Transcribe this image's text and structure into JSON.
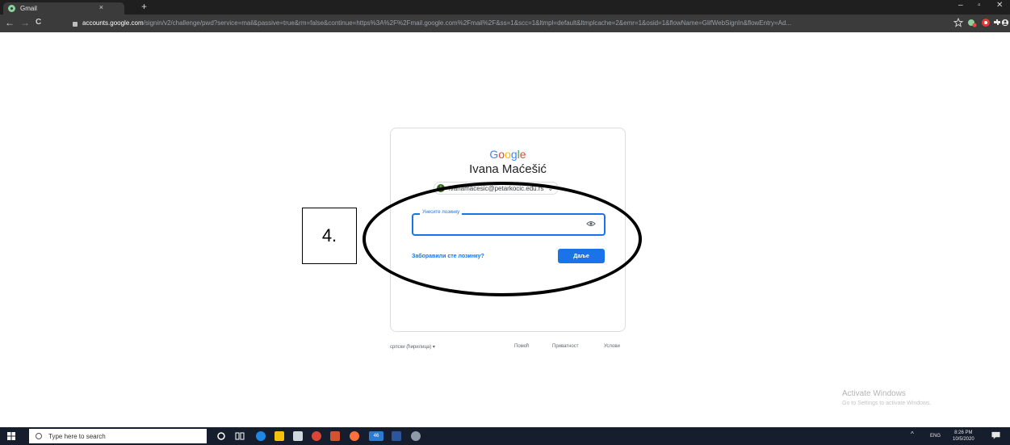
{
  "browser": {
    "tab_title": "Gmail",
    "tab_close": "×",
    "new_tab": "+",
    "win_min": "–",
    "win_max": "▫",
    "win_close": "✕",
    "back": "←",
    "forward": "→",
    "reload": "C",
    "url_host": "accounts.google.com",
    "url_path": "/signin/v2/challenge/pwd?service=mail&passive=true&rm=false&continue=https%3A%2F%2Fmail.google.com%2Fmail%2F&ss=1&scc=1&ltmpl=default&ltmplcache=2&emr=1&osid=1&flowName=GlifWebSignIn&flowEntry=Ad..."
  },
  "signin": {
    "logo_letters": [
      "G",
      "o",
      "o",
      "g",
      "l",
      "e"
    ],
    "logo_colors": [
      "#4285f4",
      "#ea4335",
      "#fbbc05",
      "#4285f4",
      "#34a853",
      "#ea4335"
    ],
    "user_name": "Ivana Maćešić",
    "account_initial": "I",
    "account_email": "ivanamacesic@petarkocic.edu.rs",
    "password_label": "Унесите лозинку",
    "password_value": "",
    "forgot_link": "Заборавили сте лозинку?",
    "next_button": "Даље"
  },
  "footer": {
    "language": "српски (ћирилица)",
    "language_arrow": "▾",
    "help": "Помоћ",
    "privacy": "Приватност",
    "terms": "Услови"
  },
  "annotation": {
    "step_label": "4."
  },
  "watermark": {
    "title": "Activate Windows",
    "subtitle": "Go to Settings to activate Windows."
  },
  "taskbar": {
    "search_placeholder": "Type here to search",
    "lang": "ENG",
    "time": "8:26 PM",
    "date": "10/5/2020",
    "tray_arrow": "^",
    "badge_count": "46"
  },
  "colors": {
    "accent": "#1a73e8",
    "taskbar": "#161d2c",
    "chrome_dark": "#3b3b3b"
  }
}
